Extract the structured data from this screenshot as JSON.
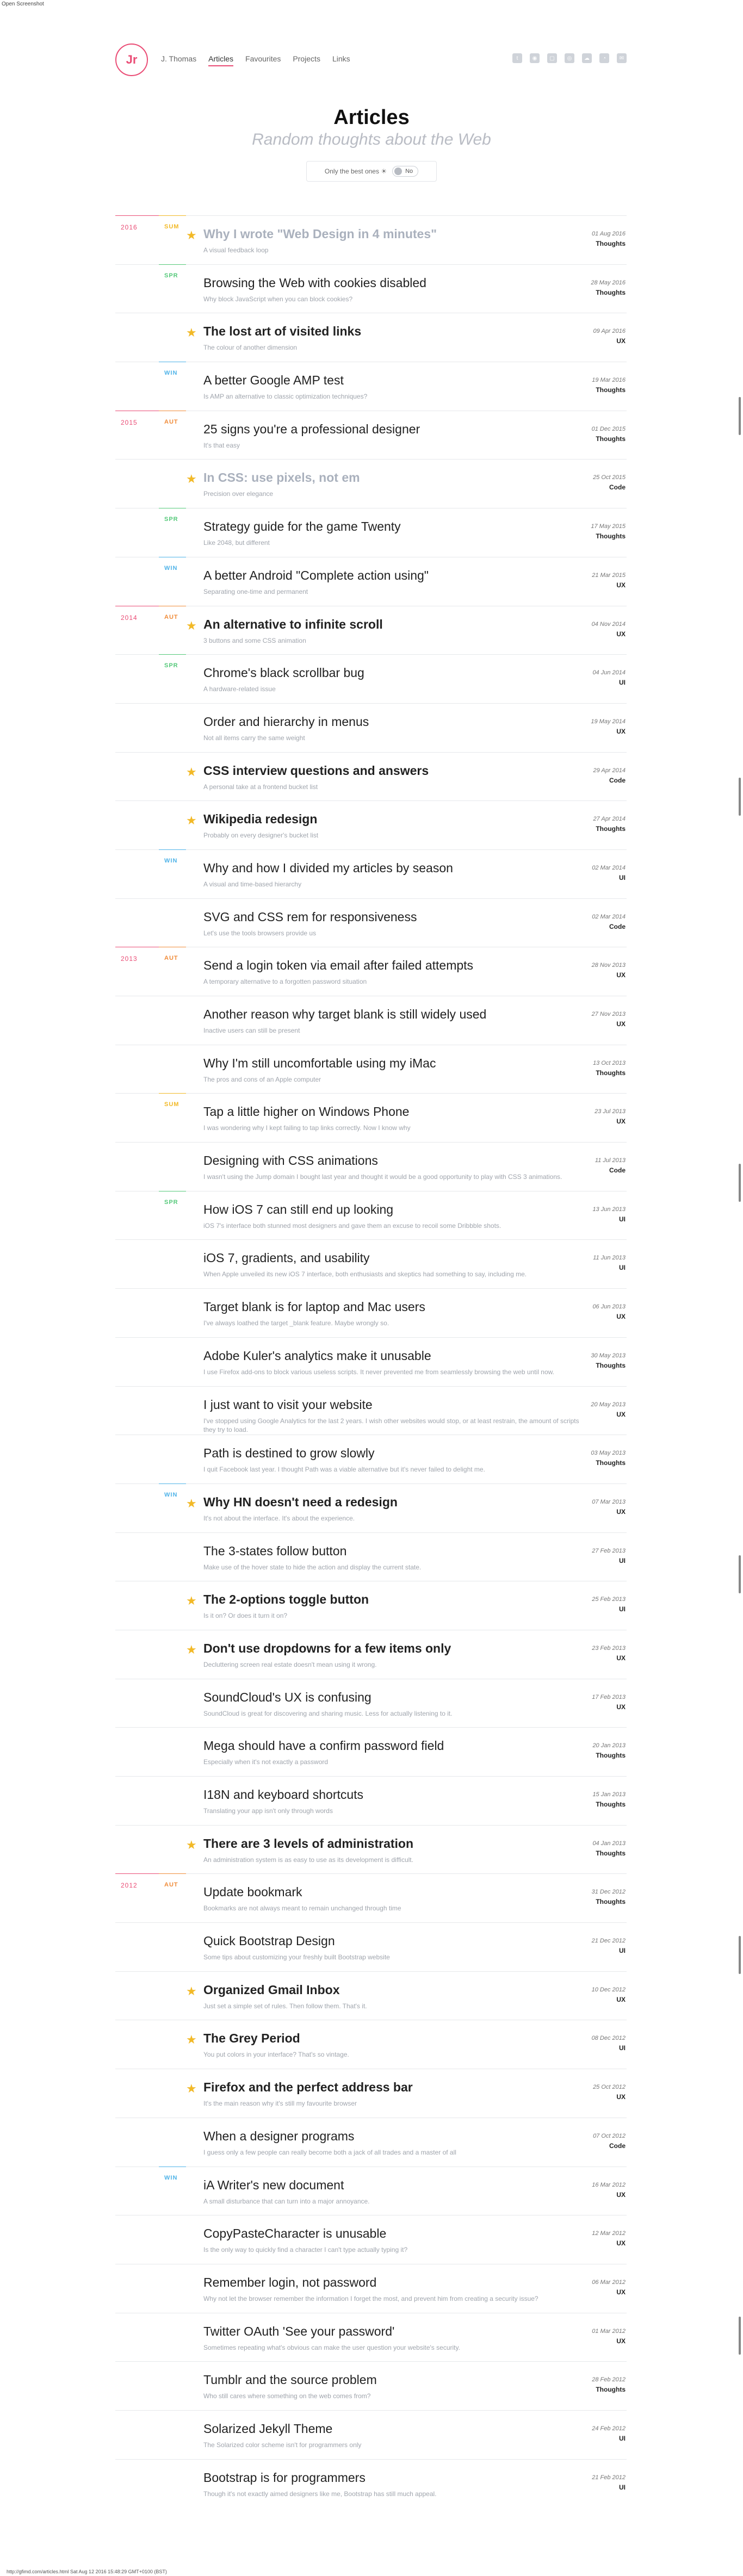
{
  "browser_label": "Open Screenshot",
  "footer_url": "http://gfimd.com/articles.html Sat Aug 12 2016 15:48:29 GMT+0100 (BST)",
  "header": {
    "logo_text": "Jr",
    "nav": [
      {
        "label": "J. Thomas"
      },
      {
        "label": "Articles",
        "active": true
      },
      {
        "label": "Favourites"
      },
      {
        "label": "Projects"
      },
      {
        "label": "Links"
      }
    ],
    "socials": [
      "twitter-icon",
      "github-icon",
      "instagram-icon",
      "dribbble-icon",
      "soundcloud-icon",
      "rss-icon",
      "mail-icon"
    ]
  },
  "page": {
    "title": "Articles",
    "subtitle": "Random thoughts about the Web",
    "filter_label": "Only the best ones ☀",
    "toggle_label": "No"
  },
  "season_colors": {
    "SUM": "#f2b927",
    "SPR": "#55c97a",
    "WIN": "#4fb3e8",
    "AUT": "#f08c3a"
  },
  "articles": [
    {
      "year": "2016",
      "season": "SUM",
      "best": true,
      "faded": true,
      "title": "Why I wrote \"Web Design in 4 minutes\"",
      "subtitle": "A visual feedback loop",
      "date": "01 Aug 2016",
      "category": "Thoughts"
    },
    {
      "season": "SPR",
      "title": "Browsing the Web with cookies disabled",
      "subtitle": "Why block JavaScript when you can block cookies?",
      "date": "28 May 2016",
      "category": "Thoughts"
    },
    {
      "best": true,
      "title": "The lost art of visited links",
      "subtitle": "The colour of another dimension",
      "date": "09 Apr 2016",
      "category": "UX"
    },
    {
      "season": "WIN",
      "title": "A better Google AMP test",
      "subtitle": "Is AMP an alternative to classic optimization techniques?",
      "date": "19 Mar 2016",
      "category": "Thoughts"
    },
    {
      "year": "2015",
      "season": "AUT",
      "title": "25 signs you're a professional designer",
      "subtitle": "It's that easy",
      "date": "01 Dec 2015",
      "category": "Thoughts"
    },
    {
      "best": true,
      "faded": true,
      "title": "In CSS: use pixels, not em",
      "subtitle": "Precision over elegance",
      "date": "25 Oct 2015",
      "category": "Code"
    },
    {
      "season": "SPR",
      "title": "Strategy guide for the game Twenty",
      "subtitle": "Like 2048, but different",
      "date": "17 May 2015",
      "category": "Thoughts"
    },
    {
      "season": "WIN",
      "title": "A better Android \"Complete action using\"",
      "subtitle": "Separating one-time and permanent",
      "date": "21 Mar 2015",
      "category": "UX"
    },
    {
      "year": "2014",
      "season": "AUT",
      "best": true,
      "title": "An alternative to infinite scroll",
      "subtitle": "3 buttons and some CSS animation",
      "date": "04 Nov 2014",
      "category": "UX"
    },
    {
      "season": "SPR",
      "title": "Chrome's black scrollbar bug",
      "subtitle": "A hardware-related issue",
      "date": "04 Jun 2014",
      "category": "UI"
    },
    {
      "title": "Order and hierarchy in menus",
      "subtitle": "Not all items carry the same weight",
      "date": "19 May 2014",
      "category": "UX"
    },
    {
      "best": true,
      "title": "CSS interview questions and answers",
      "subtitle": "A personal take at a frontend bucket list",
      "date": "29 Apr 2014",
      "category": "Code"
    },
    {
      "best": true,
      "title": "Wikipedia redesign",
      "subtitle": "Probably on every designer's bucket list",
      "date": "27 Apr 2014",
      "category": "Thoughts"
    },
    {
      "season": "WIN",
      "title": "Why and how I divided my articles by season",
      "subtitle": "A visual and time-based hierarchy",
      "date": "02 Mar 2014",
      "category": "UI"
    },
    {
      "title": "SVG and CSS rem for responsiveness",
      "subtitle": "Let's use the tools browsers provide us",
      "date": "02 Mar 2014",
      "category": "Code"
    },
    {
      "year": "2013",
      "season": "AUT",
      "title": "Send a login token via email after failed attempts",
      "subtitle": "A temporary alternative to a forgotten password situation",
      "date": "28 Nov 2013",
      "category": "UX"
    },
    {
      "title": "Another reason why target blank is still widely used",
      "subtitle": "Inactive users can still be present",
      "date": "27 Nov 2013",
      "category": "UX"
    },
    {
      "title": "Why I'm still uncomfortable using my iMac",
      "subtitle": "The pros and cons of an Apple computer",
      "date": "13 Oct 2013",
      "category": "Thoughts"
    },
    {
      "season": "SUM",
      "title": "Tap a little higher on Windows Phone",
      "subtitle": "I was wondering why I kept failing to tap links correctly. Now I know why",
      "date": "23 Jul 2013",
      "category": "UX"
    },
    {
      "title": "Designing with CSS animations",
      "subtitle": "I wasn't using the Jump domain I bought last year and thought it would be a good opportunity to play with CSS 3 animations.",
      "date": "11 Jul 2013",
      "category": "Code"
    },
    {
      "season": "SPR",
      "title": "How iOS 7 can still end up looking",
      "subtitle": "iOS 7's interface both stunned most designers and gave them an excuse to recoil some Dribbble shots.",
      "date": "13 Jun 2013",
      "category": "UI"
    },
    {
      "title": "iOS 7, gradients, and usability",
      "subtitle": "When Apple unveiled its new iOS 7 interface, both enthusiasts and skeptics had something to say, including me.",
      "date": "11 Jun 2013",
      "category": "UI"
    },
    {
      "title": "Target blank is for laptop and Mac users",
      "subtitle": "I've always loathed the target _blank feature. Maybe wrongly so.",
      "date": "06 Jun 2013",
      "category": "UX"
    },
    {
      "title": "Adobe Kuler's analytics make it unusable",
      "subtitle": "I use Firefox add-ons to block various useless scripts. It never prevented me from seamlessly browsing the web until now.",
      "date": "30 May 2013",
      "category": "Thoughts"
    },
    {
      "title": "I just want to visit your website",
      "subtitle": "I've stopped using Google Analytics for the last 2 years. I wish other websites would stop, or at least restrain, the amount of scripts they try to load.",
      "date": "20 May 2013",
      "category": "UX"
    },
    {
      "title": "Path is destined to grow slowly",
      "subtitle": "I quit Facebook last year. I thought Path was a viable alternative but it's never failed to delight me.",
      "date": "03 May 2013",
      "category": "Thoughts"
    },
    {
      "season": "WIN",
      "best": true,
      "title": "Why HN doesn't need a redesign",
      "subtitle": "It's not about the interface. It's about the experience.",
      "date": "07 Mar 2013",
      "category": "UX"
    },
    {
      "title": "The 3-states follow button",
      "subtitle": "Make use of the hover state to hide the action and display the current state.",
      "date": "27 Feb 2013",
      "category": "UI"
    },
    {
      "best": true,
      "title": "The 2-options toggle button",
      "subtitle": "Is it on? Or does it turn it on?",
      "date": "25 Feb 2013",
      "category": "UI"
    },
    {
      "best": true,
      "title": "Don't use dropdowns for a few items only",
      "subtitle": "Decluttering screen real estate doesn't mean using it wrong.",
      "date": "23 Feb 2013",
      "category": "UX"
    },
    {
      "title": "SoundCloud's UX is confusing",
      "subtitle": "SoundCloud is great for discovering and sharing music. Less for actually listening to it.",
      "date": "17 Feb 2013",
      "category": "UX"
    },
    {
      "title": "Mega should have a confirm password field",
      "subtitle": "Especially when it's not exactly a password",
      "date": "20 Jan 2013",
      "category": "Thoughts"
    },
    {
      "title": "I18N and keyboard shortcuts",
      "subtitle": "Translating your app isn't only through words",
      "date": "15 Jan 2013",
      "category": "Thoughts"
    },
    {
      "best": true,
      "title": "There are 3 levels of administration",
      "subtitle": "An administration system is as easy to use as its development is difficult.",
      "date": "04 Jan 2013",
      "category": "Thoughts"
    },
    {
      "year": "2012",
      "season": "AUT",
      "title": "Update bookmark",
      "subtitle": "Bookmarks are not always meant to remain unchanged through time",
      "date": "31 Dec 2012",
      "category": "Thoughts"
    },
    {
      "title": "Quick Bootstrap Design",
      "subtitle": "Some tips about customizing your freshly built Bootstrap website",
      "date": "21 Dec 2012",
      "category": "UI"
    },
    {
      "best": true,
      "title": "Organized Gmail Inbox",
      "subtitle": "Just set a simple set of rules. Then follow them. That's it.",
      "date": "10 Dec 2012",
      "category": "UX"
    },
    {
      "best": true,
      "title": "The Grey Period",
      "subtitle": "You put colors in your interface? That's so vintage.",
      "date": "08 Dec 2012",
      "category": "UI"
    },
    {
      "best": true,
      "title": "Firefox and the perfect address bar",
      "subtitle": "It's the main reason why it's still my favourite browser",
      "date": "25 Oct 2012",
      "category": "UX"
    },
    {
      "title": "When a designer programs",
      "subtitle": "I guess only a few people can really become both a jack of all trades and a master of all",
      "date": "07 Oct 2012",
      "category": "Code"
    },
    {
      "season": "WIN",
      "title": "iA Writer's new document",
      "subtitle": "A small disturbance that can turn into a major annoyance.",
      "date": "16 Mar 2012",
      "category": "UX"
    },
    {
      "title": "CopyPasteCharacter is unusable",
      "subtitle": "Is the only way to quickly find a character I can't type actually typing it?",
      "date": "12 Mar 2012",
      "category": "UX"
    },
    {
      "title": "Remember login, not password",
      "subtitle": "Why not let the browser remember the information I forget the most, and prevent him from creating a security issue?",
      "date": "06 Mar 2012",
      "category": "UX"
    },
    {
      "title": "Twitter OAuth 'See your password'",
      "subtitle": "Sometimes repeating what's obvious can make the user question your website's security.",
      "date": "01 Mar 2012",
      "category": "UX"
    },
    {
      "title": "Tumblr and the source problem",
      "subtitle": "Who still cares where something on the web comes from?",
      "date": "28 Feb 2012",
      "category": "Thoughts"
    },
    {
      "title": "Solarized Jekyll Theme",
      "subtitle": "The Solarized color scheme isn't for programmers only",
      "date": "24 Feb 2012",
      "category": "UI"
    },
    {
      "title": "Bootstrap is for programmers",
      "subtitle": "Though it's not exactly aimed designers like me, Bootstrap has still much appeal.",
      "date": "21 Feb 2012",
      "category": "UI"
    }
  ]
}
